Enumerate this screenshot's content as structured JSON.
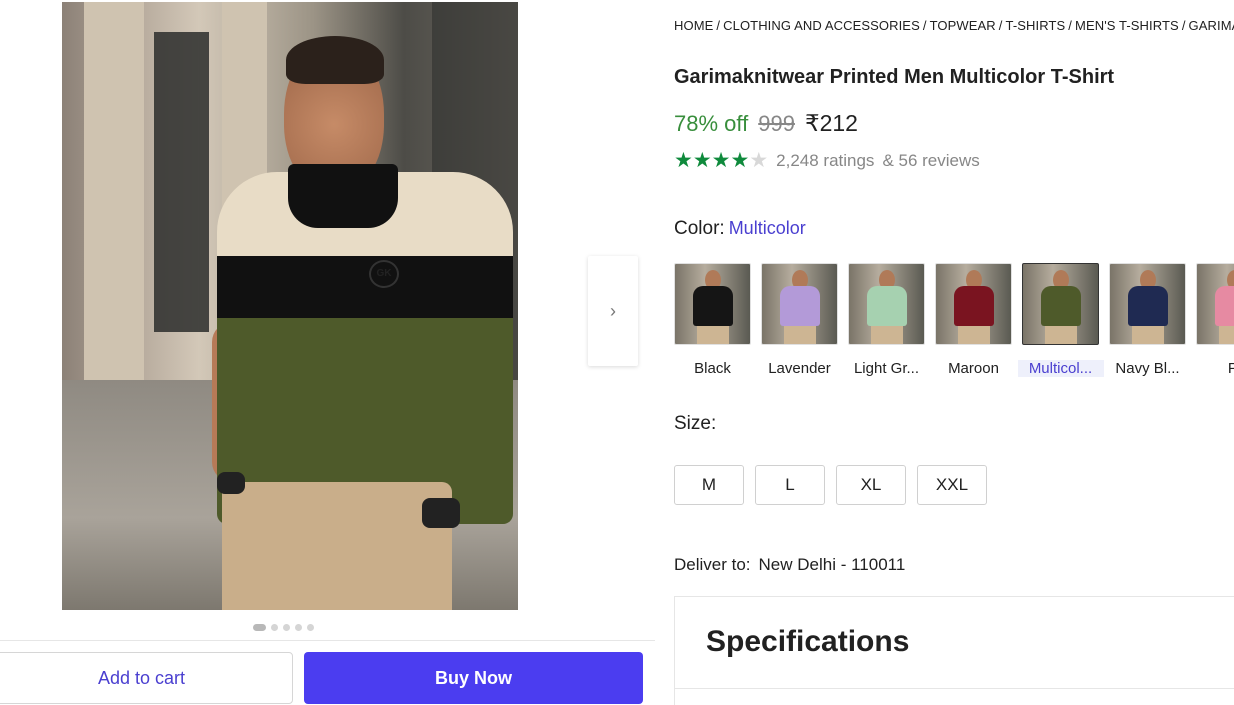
{
  "breadcrumb": [
    "HOME",
    "CLOTHING AND ACCESSORIES",
    "TOPWEAR",
    "T-SHIRTS",
    "MEN'S T-SHIRTS",
    "GARIMAKNITWEAR T-SHIRTS"
  ],
  "product": {
    "title": "Garimaknitwear Printed Men Multicolor T-Shirt",
    "discount": "78% off",
    "mrp": "999",
    "price": "₹212",
    "rating": 4,
    "rating_max": 5,
    "ratings_text": "2,248 ratings",
    "reviews_text": "& 56 reviews",
    "logo_text": "GK"
  },
  "gallery": {
    "next_icon": "›",
    "dot_count": 5,
    "active_dot": 0
  },
  "color": {
    "label": "Color:",
    "selected": "Multicolor",
    "options": [
      {
        "name": "Black",
        "shirt": "#151515"
      },
      {
        "name": "Lavender",
        "shirt": "#b39ad8"
      },
      {
        "name": "Light Gr...",
        "shirt": "#a6d1b0"
      },
      {
        "name": "Maroon",
        "shirt": "#7a1420"
      },
      {
        "name": "Multicol...",
        "shirt": "#4e5a2a",
        "selected": true
      },
      {
        "name": "Navy Bl...",
        "shirt": "#1f2a52"
      },
      {
        "name": "Pi",
        "shirt": "#e68aa2"
      }
    ]
  },
  "size": {
    "label": "Size:",
    "options": [
      "M",
      "L",
      "XL",
      "XXL"
    ]
  },
  "delivery": {
    "label": "Deliver to:",
    "location": "New Delhi - 110011"
  },
  "specifications": {
    "title": "Specifications"
  },
  "actions": {
    "add_to_cart": "Add to cart",
    "buy_now": "Buy Now"
  },
  "colors": {
    "accent": "#4b3df0",
    "discount_green": "#388e3c",
    "star_green": "#0f8a3c"
  }
}
